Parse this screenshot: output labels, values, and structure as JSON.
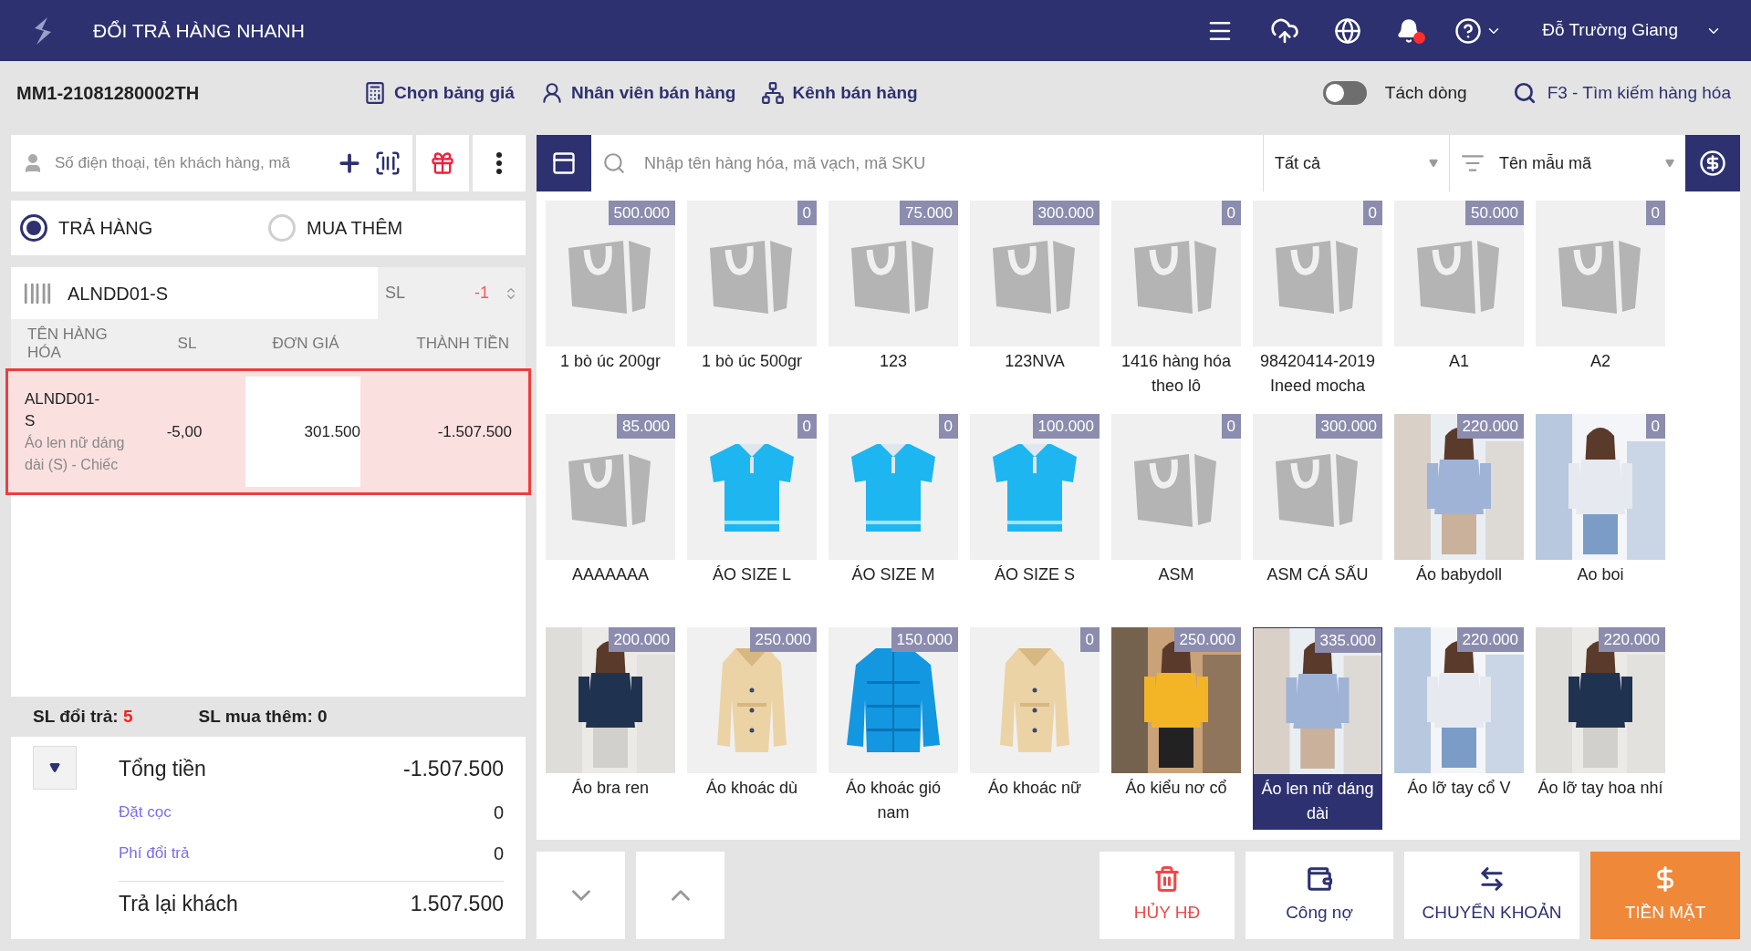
{
  "app_bar": {
    "title": "ĐỔI TRẢ HÀNG NHANH",
    "user": "Đỗ Trường Giang",
    "has_notification": true
  },
  "toolbar": {
    "order_code": "MM1-21081280002TH",
    "actions": [
      {
        "label": "Chọn bảng giá",
        "kind": "price"
      },
      {
        "label": "Nhân viên bán hàng",
        "kind": "staff"
      },
      {
        "label": "Kênh bán hàng",
        "kind": "channel"
      }
    ],
    "split_toggle": {
      "label": "Tách dòng",
      "on": false
    },
    "search_shortcut": "F3 - Tìm kiếm hàng hóa"
  },
  "customer_search": {
    "placeholder": "Số điện thoại, tên khách hàng, mã"
  },
  "modes": [
    {
      "label": "TRẢ HÀNG",
      "selected": true
    },
    {
      "label": "MUA THÊM",
      "selected": false
    }
  ],
  "barcode_entry": {
    "value": "ALNDD01-S",
    "qty_label": "SL",
    "qty": "-1"
  },
  "cart": {
    "columns": [
      "TÊN HÀNG HÓA",
      "SL",
      "ĐƠN GIÁ",
      "THÀNH TIỀN"
    ],
    "rows": [
      {
        "code": "ALNDD01-S",
        "name": "Áo len nữ dáng dài (S) - Chiếc",
        "qty": "-5,00",
        "price": "301.500",
        "total": "-1.507.500",
        "selected": true
      }
    ]
  },
  "counts": {
    "return_label": "SL đổi trả:",
    "return_value": "5",
    "extra_label": "SL mua thêm:",
    "extra_value": "0"
  },
  "summary": [
    {
      "label": "Tổng tiền",
      "value": "-1.507.500",
      "kind": "main"
    },
    {
      "label": "Đặt cọc",
      "value": "0",
      "kind": "link"
    },
    {
      "label": "Phí đổi trả",
      "value": "0",
      "kind": "link"
    },
    {
      "label": "Trả lại khách",
      "value": "1.507.500",
      "kind": "total"
    }
  ],
  "product_search": {
    "placeholder": "Nhập tên hàng hóa, mã vạch, mã SKU",
    "category": "Tất cả",
    "sort": "Tên mẫu mã"
  },
  "products": [
    {
      "name": "1 bò úc 200gr",
      "price": "500.000",
      "kind": "bag",
      "selected": false
    },
    {
      "name": "1 bò úc 500gr",
      "price": "0",
      "kind": "bag",
      "selected": false
    },
    {
      "name": "123",
      "price": "75.000",
      "kind": "bag",
      "selected": false
    },
    {
      "name": "123NVA",
      "price": "300.000",
      "kind": "bag",
      "selected": false
    },
    {
      "name": "1416 hàng hóa theo lô",
      "price": "0",
      "kind": "bag",
      "selected": false
    },
    {
      "name": "98420414-2019 Ineed mocha",
      "price": "0",
      "kind": "bag",
      "selected": false
    },
    {
      "name": "A1",
      "price": "50.000",
      "kind": "bag",
      "selected": false
    },
    {
      "name": "A2",
      "price": "0",
      "kind": "bag",
      "selected": false
    },
    {
      "name": "AAAAAAA",
      "price": "85.000",
      "kind": "bag",
      "selected": false
    },
    {
      "name": "ÁO SIZE L",
      "price": "0",
      "kind": "shirt",
      "selected": false
    },
    {
      "name": "ÁO SIZE M",
      "price": "0",
      "kind": "shirt",
      "selected": false
    },
    {
      "name": "ÁO SIZE S",
      "price": "100.000",
      "kind": "shirt",
      "selected": false
    },
    {
      "name": "ASM",
      "price": "0",
      "kind": "bag",
      "selected": false
    },
    {
      "name": "ASM CÁ SẤU",
      "price": "300.000",
      "kind": "bag",
      "selected": false
    },
    {
      "name": "Áo babydoll",
      "price": "220.000",
      "kind": "picture",
      "selected": false
    },
    {
      "name": "Ao boi",
      "price": "0",
      "kind": "picture",
      "selected": false
    },
    {
      "name": "Áo bra ren",
      "price": "200.000",
      "kind": "picture",
      "selected": false
    },
    {
      "name": "Áo khoác dù",
      "price": "250.000",
      "kind": "coat",
      "selected": false
    },
    {
      "name": "Áo khoác gió nam",
      "price": "150.000",
      "kind": "jacket",
      "selected": false
    },
    {
      "name": "Áo khoác nữ",
      "price": "0",
      "kind": "coat",
      "selected": false
    },
    {
      "name": "Áo kiểu nơ cổ",
      "price": "250.000",
      "kind": "picture",
      "selected": false
    },
    {
      "name": "Áo len nữ dáng dài",
      "price": "335.000",
      "kind": "picture",
      "selected": true
    },
    {
      "name": "Áo lỡ tay cổ V",
      "price": "220.000",
      "kind": "picture",
      "selected": false
    },
    {
      "name": "Áo lỡ tay hoa nhí",
      "price": "220.000",
      "kind": "picture",
      "selected": false
    }
  ],
  "payment_buttons": [
    {
      "label": "HỦY HĐ",
      "kind": "cancel"
    },
    {
      "label": "Công nợ",
      "kind": "debt"
    },
    {
      "label": "CHUYỂN KHOẢN",
      "kind": "transfer"
    },
    {
      "label": "TIỀN MẶT",
      "kind": "cash"
    }
  ]
}
